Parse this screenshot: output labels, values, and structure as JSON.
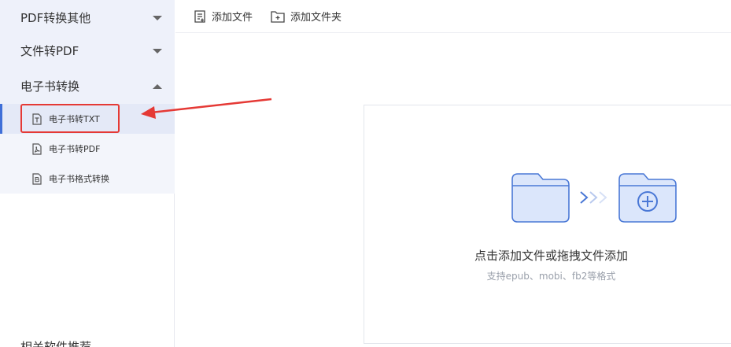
{
  "sidebar": {
    "categories": [
      {
        "label": "PDF转换其他",
        "state": "collapsed"
      },
      {
        "label": "文件转PDF",
        "state": "collapsed"
      },
      {
        "label": "电子书转换",
        "state": "expanded"
      }
    ],
    "subitems": [
      {
        "label": "电子书转TXT",
        "icon": "txt-file-icon",
        "active": true
      },
      {
        "label": "电子书转PDF",
        "icon": "pdf-file-icon",
        "active": false
      },
      {
        "label": "电子书格式转换",
        "icon": "ebook-file-icon",
        "active": false
      }
    ],
    "related_label": "相关软件推荐"
  },
  "toolbar": {
    "add_file_label": "添加文件",
    "add_folder_label": "添加文件夹"
  },
  "dropzone": {
    "main_text": "点击添加文件或拖拽文件添加",
    "sub_text": "支持epub、mobi、fb2等格式"
  },
  "colors": {
    "accent": "#3f6fd8",
    "highlight_red": "#e53935",
    "folder_fill": "#dbe6fb",
    "folder_stroke": "#4a78d6"
  }
}
